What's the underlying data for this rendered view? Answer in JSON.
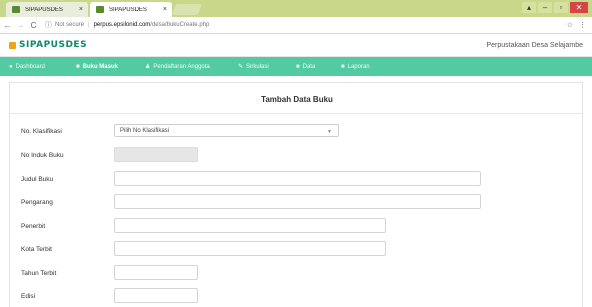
{
  "browser": {
    "tabs": [
      {
        "title": "SIPAPUSDES"
      },
      {
        "title": "SIPAPUSDES"
      }
    ],
    "close_glyph": "×",
    "address": {
      "security": "Not secure",
      "domain": "perpus.epsilonid.com",
      "path": "/desa/bukuCreate.php"
    }
  },
  "site": {
    "logo_text": "SIPAPUSDES",
    "name": "Perpustakaan Desa Selajambe"
  },
  "nav": {
    "items": [
      {
        "label": "Dashboard",
        "icon": "●"
      },
      {
        "label": "Buku Masuk",
        "icon": "■"
      },
      {
        "label": "Pendaftaran Anggota",
        "icon": "♟"
      },
      {
        "label": "Sirkulasi",
        "icon": "✎"
      },
      {
        "label": "Data",
        "icon": "■"
      },
      {
        "label": "Laporan",
        "icon": "■"
      }
    ],
    "active_index": 1
  },
  "form": {
    "title": "Tambah Data Buku",
    "fields": {
      "klasifikasi": {
        "label": "No. Klasifikasi",
        "value": "Pilih No Klasifikasi"
      },
      "induk": {
        "label": "No Induk Buku",
        "value": ""
      },
      "judul": {
        "label": "Judul Buku",
        "value": ""
      },
      "pengarang": {
        "label": "Pengarang",
        "value": ""
      },
      "penerbit": {
        "label": "Penerbit",
        "value": ""
      },
      "kota": {
        "label": "Kota Terbit",
        "value": ""
      },
      "tahun": {
        "label": "Tahun Terbit",
        "value": ""
      },
      "edisi": {
        "label": "Edisi",
        "value": ""
      }
    }
  },
  "colors": {
    "nav_bg": "#52cba2",
    "logo_green": "#0d8a6a",
    "tabstrip": "#c8d78a"
  }
}
